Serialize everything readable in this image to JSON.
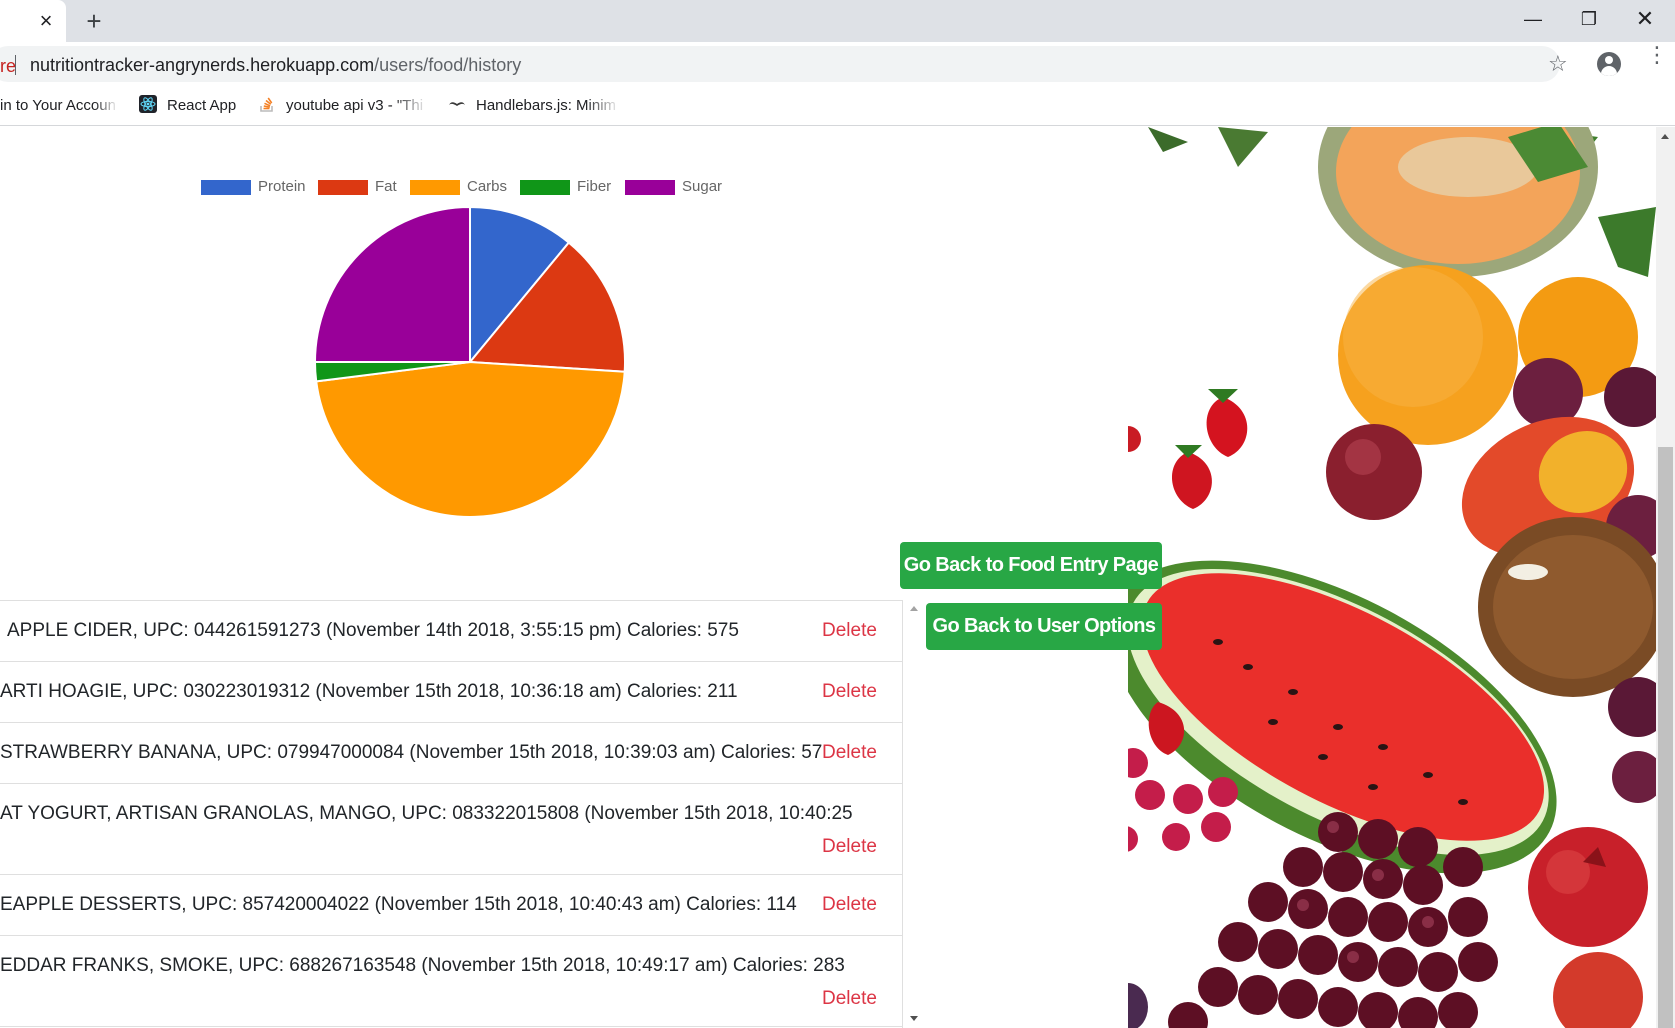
{
  "browser": {
    "url_prefix": "ure",
    "url_host": "nutritiontracker-angrynerds.herokuapp.com",
    "url_path": "/users/food/history",
    "tab_close": "×",
    "new_tab": "+",
    "min_glyph": "—",
    "max_glyph": "❐",
    "close_glyph": "✕",
    "star_glyph": "☆",
    "menu_glyph": "⋮",
    "bookmarks": [
      {
        "label": "in to Your Accoun",
        "icon": "none"
      },
      {
        "label": "React App",
        "icon": "react-icon"
      },
      {
        "label": "youtube api v3 - \"Thi",
        "icon": "stackoverflow-icon"
      },
      {
        "label": "Handlebars.js: Minim",
        "icon": "handlebars-icon"
      }
    ]
  },
  "chart_data": {
    "type": "pie",
    "legend": [
      "Protein",
      "Fat",
      "Carbs",
      "Fiber",
      "Sugar"
    ],
    "categories": [
      "Protein",
      "Fat",
      "Carbs",
      "Fiber",
      "Sugar"
    ],
    "values": [
      11,
      15,
      47,
      2,
      25
    ],
    "colors": [
      "#3366cc",
      "#dc3912",
      "#ff9900",
      "#109618",
      "#990099"
    ]
  },
  "buttons": {
    "food_entry": "Go Back to Food Entry Page",
    "user_options": "Go Back to User Options"
  },
  "history": [
    {
      "text": "APPLE CIDER, UPC: 044261591273 (November 14th 2018, 3:55:15 pm) Calories: 575",
      "delete": "Delete",
      "wrap": false
    },
    {
      "text": "ARTI HOAGIE, UPC: 030223019312 (November 15th 2018, 10:36:18 am) Calories: 211",
      "delete": "Delete",
      "wrap": false
    },
    {
      "text": "STRAWBERRY BANANA, UPC: 079947000084 (November 15th 2018, 10:39:03 am) Calories: 57",
      "delete": "Delete",
      "wrap": false
    },
    {
      "text": "AT YOGURT, ARTISAN GRANOLAS, MANGO, UPC: 083322015808 (November 15th 2018, 10:40:25",
      "delete": "Delete",
      "wrap": true
    },
    {
      "text": "EAPPLE DESSERTS, UPC: 857420004022 (November 15th 2018, 10:40:43 am) Calories: 114",
      "delete": "Delete",
      "wrap": false
    },
    {
      "text": "EDDAR FRANKS, SMOKE, UPC: 688267163548 (November 15th 2018, 10:49:17 am) Calories: 283",
      "delete": "Delete",
      "wrap": true
    }
  ]
}
